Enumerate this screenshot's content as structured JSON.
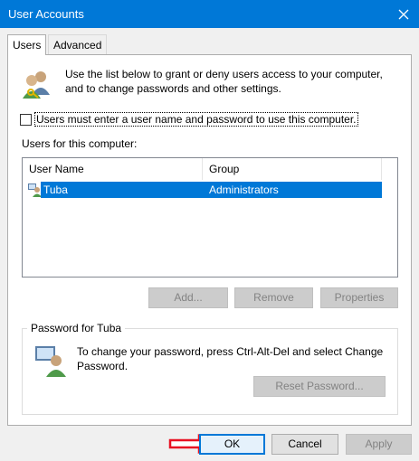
{
  "window": {
    "title": "User Accounts"
  },
  "tabs": [
    {
      "label": "Users",
      "active": true
    },
    {
      "label": "Advanced",
      "active": false
    }
  ],
  "intro": {
    "text": "Use the list below to grant or deny users access to your computer, and to change passwords and other settings."
  },
  "require_login": {
    "label": "Users must enter a user name and password to use this computer.",
    "checked": false
  },
  "users_list": {
    "label": "Users for this computer:",
    "columns": [
      "User Name",
      "Group"
    ],
    "rows": [
      {
        "name": "Tuba",
        "group": "Administrators",
        "selected": true
      }
    ]
  },
  "list_buttons": {
    "add": "Add...",
    "remove": "Remove",
    "properties": "Properties"
  },
  "password_group": {
    "title": "Password for Tuba",
    "text": "To change your password, press Ctrl-Alt-Del and select Change Password.",
    "reset_button": "Reset Password..."
  },
  "dialog_buttons": {
    "ok": "OK",
    "cancel": "Cancel",
    "apply": "Apply"
  },
  "icons": {
    "close": "close-icon",
    "users": "users-icon",
    "user": "user-icon",
    "password": "user-password-icon",
    "annotation": "red-arrow-icon"
  },
  "colors": {
    "accent": "#0078d7",
    "annotation": "#e81123"
  }
}
